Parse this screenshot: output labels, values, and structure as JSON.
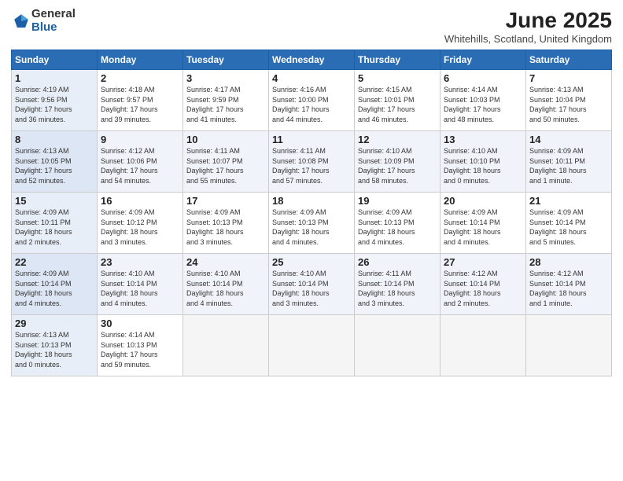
{
  "logo": {
    "general": "General",
    "blue": "Blue"
  },
  "header": {
    "title": "June 2025",
    "location": "Whitehills, Scotland, United Kingdom"
  },
  "days_of_week": [
    "Sunday",
    "Monday",
    "Tuesday",
    "Wednesday",
    "Thursday",
    "Friday",
    "Saturday"
  ],
  "weeks": [
    [
      {
        "day": 1,
        "info": "Sunrise: 4:19 AM\nSunset: 9:56 PM\nDaylight: 17 hours\nand 36 minutes."
      },
      {
        "day": 2,
        "info": "Sunrise: 4:18 AM\nSunset: 9:57 PM\nDaylight: 17 hours\nand 39 minutes."
      },
      {
        "day": 3,
        "info": "Sunrise: 4:17 AM\nSunset: 9:59 PM\nDaylight: 17 hours\nand 41 minutes."
      },
      {
        "day": 4,
        "info": "Sunrise: 4:16 AM\nSunset: 10:00 PM\nDaylight: 17 hours\nand 44 minutes."
      },
      {
        "day": 5,
        "info": "Sunrise: 4:15 AM\nSunset: 10:01 PM\nDaylight: 17 hours\nand 46 minutes."
      },
      {
        "day": 6,
        "info": "Sunrise: 4:14 AM\nSunset: 10:03 PM\nDaylight: 17 hours\nand 48 minutes."
      },
      {
        "day": 7,
        "info": "Sunrise: 4:13 AM\nSunset: 10:04 PM\nDaylight: 17 hours\nand 50 minutes."
      }
    ],
    [
      {
        "day": 8,
        "info": "Sunrise: 4:13 AM\nSunset: 10:05 PM\nDaylight: 17 hours\nand 52 minutes."
      },
      {
        "day": 9,
        "info": "Sunrise: 4:12 AM\nSunset: 10:06 PM\nDaylight: 17 hours\nand 54 minutes."
      },
      {
        "day": 10,
        "info": "Sunrise: 4:11 AM\nSunset: 10:07 PM\nDaylight: 17 hours\nand 55 minutes."
      },
      {
        "day": 11,
        "info": "Sunrise: 4:11 AM\nSunset: 10:08 PM\nDaylight: 17 hours\nand 57 minutes."
      },
      {
        "day": 12,
        "info": "Sunrise: 4:10 AM\nSunset: 10:09 PM\nDaylight: 17 hours\nand 58 minutes."
      },
      {
        "day": 13,
        "info": "Sunrise: 4:10 AM\nSunset: 10:10 PM\nDaylight: 18 hours\nand 0 minutes."
      },
      {
        "day": 14,
        "info": "Sunrise: 4:09 AM\nSunset: 10:11 PM\nDaylight: 18 hours\nand 1 minute."
      }
    ],
    [
      {
        "day": 15,
        "info": "Sunrise: 4:09 AM\nSunset: 10:11 PM\nDaylight: 18 hours\nand 2 minutes."
      },
      {
        "day": 16,
        "info": "Sunrise: 4:09 AM\nSunset: 10:12 PM\nDaylight: 18 hours\nand 3 minutes."
      },
      {
        "day": 17,
        "info": "Sunrise: 4:09 AM\nSunset: 10:13 PM\nDaylight: 18 hours\nand 3 minutes."
      },
      {
        "day": 18,
        "info": "Sunrise: 4:09 AM\nSunset: 10:13 PM\nDaylight: 18 hours\nand 4 minutes."
      },
      {
        "day": 19,
        "info": "Sunrise: 4:09 AM\nSunset: 10:13 PM\nDaylight: 18 hours\nand 4 minutes."
      },
      {
        "day": 20,
        "info": "Sunrise: 4:09 AM\nSunset: 10:14 PM\nDaylight: 18 hours\nand 4 minutes."
      },
      {
        "day": 21,
        "info": "Sunrise: 4:09 AM\nSunset: 10:14 PM\nDaylight: 18 hours\nand 5 minutes."
      }
    ],
    [
      {
        "day": 22,
        "info": "Sunrise: 4:09 AM\nSunset: 10:14 PM\nDaylight: 18 hours\nand 4 minutes."
      },
      {
        "day": 23,
        "info": "Sunrise: 4:10 AM\nSunset: 10:14 PM\nDaylight: 18 hours\nand 4 minutes."
      },
      {
        "day": 24,
        "info": "Sunrise: 4:10 AM\nSunset: 10:14 PM\nDaylight: 18 hours\nand 4 minutes."
      },
      {
        "day": 25,
        "info": "Sunrise: 4:10 AM\nSunset: 10:14 PM\nDaylight: 18 hours\nand 3 minutes."
      },
      {
        "day": 26,
        "info": "Sunrise: 4:11 AM\nSunset: 10:14 PM\nDaylight: 18 hours\nand 3 minutes."
      },
      {
        "day": 27,
        "info": "Sunrise: 4:12 AM\nSunset: 10:14 PM\nDaylight: 18 hours\nand 2 minutes."
      },
      {
        "day": 28,
        "info": "Sunrise: 4:12 AM\nSunset: 10:14 PM\nDaylight: 18 hours\nand 1 minute."
      }
    ],
    [
      {
        "day": 29,
        "info": "Sunrise: 4:13 AM\nSunset: 10:13 PM\nDaylight: 18 hours\nand 0 minutes."
      },
      {
        "day": 30,
        "info": "Sunrise: 4:14 AM\nSunset: 10:13 PM\nDaylight: 17 hours\nand 59 minutes."
      },
      null,
      null,
      null,
      null,
      null
    ]
  ]
}
